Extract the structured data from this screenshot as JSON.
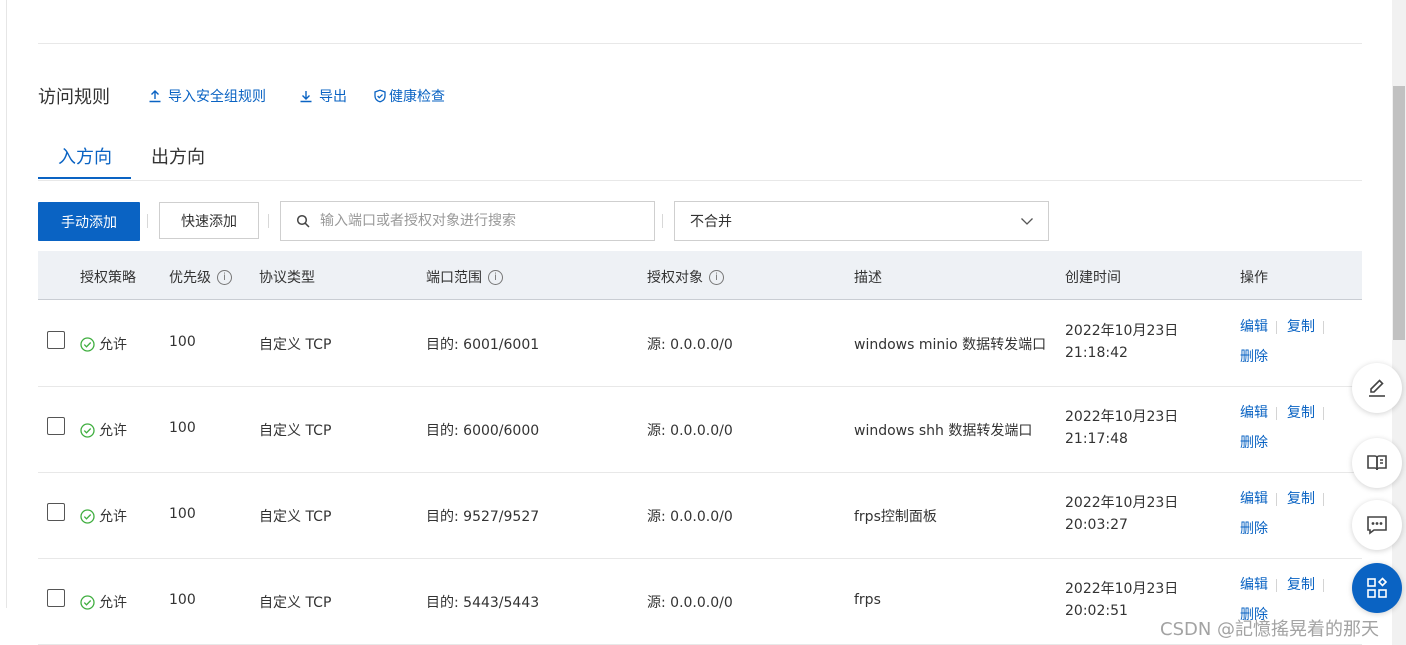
{
  "section": {
    "title": "访问规则",
    "actions": [
      {
        "label": "导入安全组规则",
        "icon": "upload-icon"
      },
      {
        "label": "导出",
        "icon": "download-icon"
      },
      {
        "label": "健康检查",
        "icon": "shield-check-icon"
      }
    ]
  },
  "tabs": [
    {
      "label": "入方向",
      "active": true
    },
    {
      "label": "出方向",
      "active": false
    }
  ],
  "toolbar": {
    "manual_add": "手动添加",
    "quick_add": "快速添加",
    "search_placeholder": "输入端口或者授权对象进行搜索",
    "merge_select": "不合并"
  },
  "table": {
    "headers": {
      "policy": "授权策略",
      "priority": "优先级",
      "protocol": "协议类型",
      "port_range": "端口范围",
      "auth_object": "授权对象",
      "description": "描述",
      "created": "创建时间",
      "actions": "操作"
    },
    "rows": [
      {
        "policy": "允许",
        "priority": "100",
        "protocol": "自定义 TCP",
        "port": "目的: 6001/6001",
        "source": "源: 0.0.0.0/0",
        "description": "windows minio 数据转发端口",
        "date": "2022年10月23日",
        "time": "21:18:42"
      },
      {
        "policy": "允许",
        "priority": "100",
        "protocol": "自定义 TCP",
        "port": "目的: 6000/6000",
        "source": "源: 0.0.0.0/0",
        "description": "windows shh 数据转发端口",
        "date": "2022年10月23日",
        "time": "21:17:48"
      },
      {
        "policy": "允许",
        "priority": "100",
        "protocol": "自定义 TCP",
        "port": "目的: 9527/9527",
        "source": "源: 0.0.0.0/0",
        "description": "frps控制面板",
        "date": "2022年10月23日",
        "time": "20:03:27"
      },
      {
        "policy": "允许",
        "priority": "100",
        "protocol": "自定义 TCP",
        "port": "目的: 5443/5443",
        "source": "源: 0.0.0.0/0",
        "description": "frps",
        "date": "2022年10月23日",
        "time": "20:02:51"
      }
    ],
    "row_actions": {
      "edit": "编辑",
      "copy": "复制",
      "delete": "删除"
    }
  },
  "floating_buttons": [
    "edit-icon",
    "book-icon",
    "chat-icon",
    "apps-icon"
  ],
  "watermark": "CSDN @記憶搖晃着的那天",
  "colors": {
    "accent": "#0a63c3",
    "header_bg": "#eef1f5",
    "success": "#3fae3f"
  }
}
